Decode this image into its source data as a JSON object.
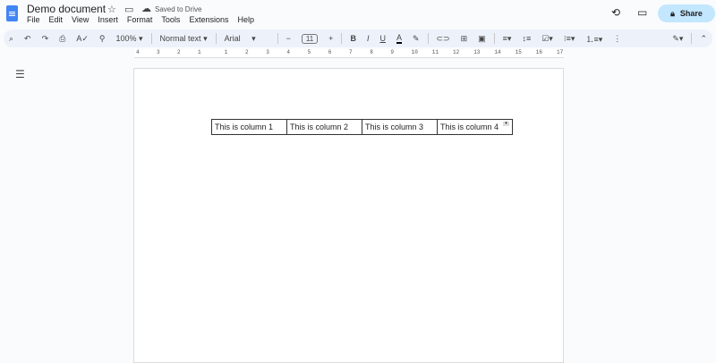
{
  "doc": {
    "title": "Demo document",
    "saved_status": "Saved to Drive"
  },
  "menu": [
    "File",
    "Edit",
    "View",
    "Insert",
    "Format",
    "Tools",
    "Extensions",
    "Help"
  ],
  "share_label": "Share",
  "toolbar": {
    "zoom": "100%",
    "style": "Normal text",
    "font": "Arial",
    "font_size": "11"
  },
  "ruler": {
    "labels": [
      "4",
      "3",
      "2",
      "1",
      "1",
      "2",
      "3",
      "4",
      "5",
      "6",
      "7",
      "8",
      "9",
      "10",
      "11",
      "12",
      "13",
      "14",
      "15",
      "16",
      "17"
    ]
  },
  "table": {
    "cells": [
      "This is column 1",
      "This is column 2",
      "This is column 3",
      "This is column 4"
    ]
  }
}
